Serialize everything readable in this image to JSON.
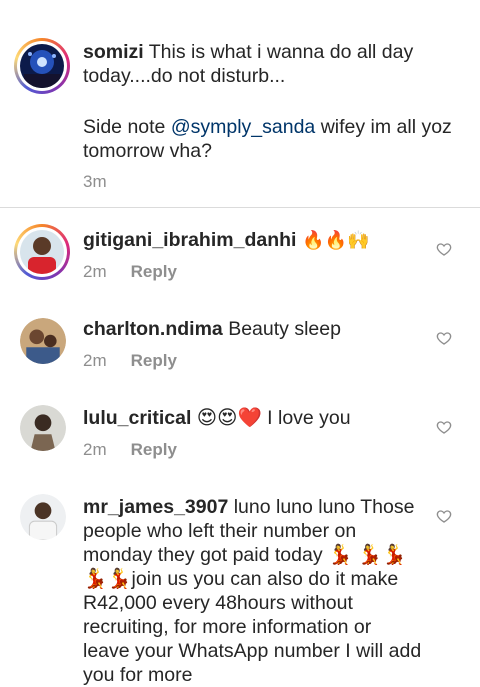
{
  "caption": {
    "username": "somizi",
    "text_part1": " This is what i wanna do all day today....do not disturb...",
    "text_part2": "Side note ",
    "mention": "@symply_sanda",
    "text_part3": " wifey im all yoz tomorrow vha?",
    "time": "3m"
  },
  "comments": [
    {
      "username": "gitigani_ibrahim_danhi",
      "text": " 🔥🔥🙌",
      "time": "2m",
      "reply_label": "Reply"
    },
    {
      "username": "charlton.ndima",
      "text": " Beauty sleep",
      "time": "2m",
      "reply_label": "Reply"
    },
    {
      "username": "lulu_critical",
      "text": " 😍😍❤️ I love you",
      "time": "2m",
      "reply_label": "Reply"
    },
    {
      "username": "mr_james_3907",
      "text": " luno luno luno Those people who left their number on monday they got paid today 💃 💃💃💃💃join us you can also do it make R42,000 every 48hours without recruiting, for more information or leave your WhatsApp number I will add you for more"
    }
  ],
  "colors": {
    "mention": "#003569",
    "meta": "#8e8e8e",
    "divider": "#dbdbdb"
  },
  "icons": [
    "like-heart-icon"
  ]
}
